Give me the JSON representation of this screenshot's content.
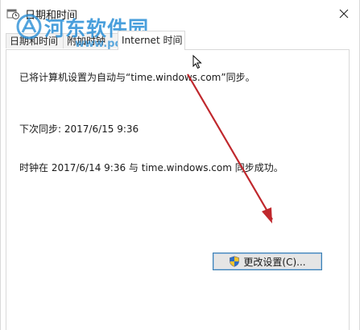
{
  "window": {
    "title": "日期和时间",
    "icons": {
      "app": "clock-calendar-icon",
      "close": "close-icon"
    }
  },
  "watermark": {
    "text": "河东软件园",
    "url": "www.pc0359.cn",
    "color": "#2a8fd6"
  },
  "tabs": [
    {
      "label": "日期和时间"
    },
    {
      "label": "附加时钟"
    },
    {
      "label": "Internet 时间",
      "active": true
    }
  ],
  "panel": {
    "sync_config_text": "已将计算机设置为自动与“time.windows.com”同步。",
    "next_sync_text": "下次同步: 2017/6/15 9:36",
    "last_sync_text": "时钟在 2017/6/14 9:36 与 time.windows.com 同步成功。",
    "change_settings_label": "更改设置(C)..."
  },
  "annotation": {
    "arrow_color": "#c0282d"
  },
  "colors": {
    "button_border": "#3c7fb1",
    "button_bg": "#e5e5e5",
    "tab_border": "#d9d9d9"
  }
}
